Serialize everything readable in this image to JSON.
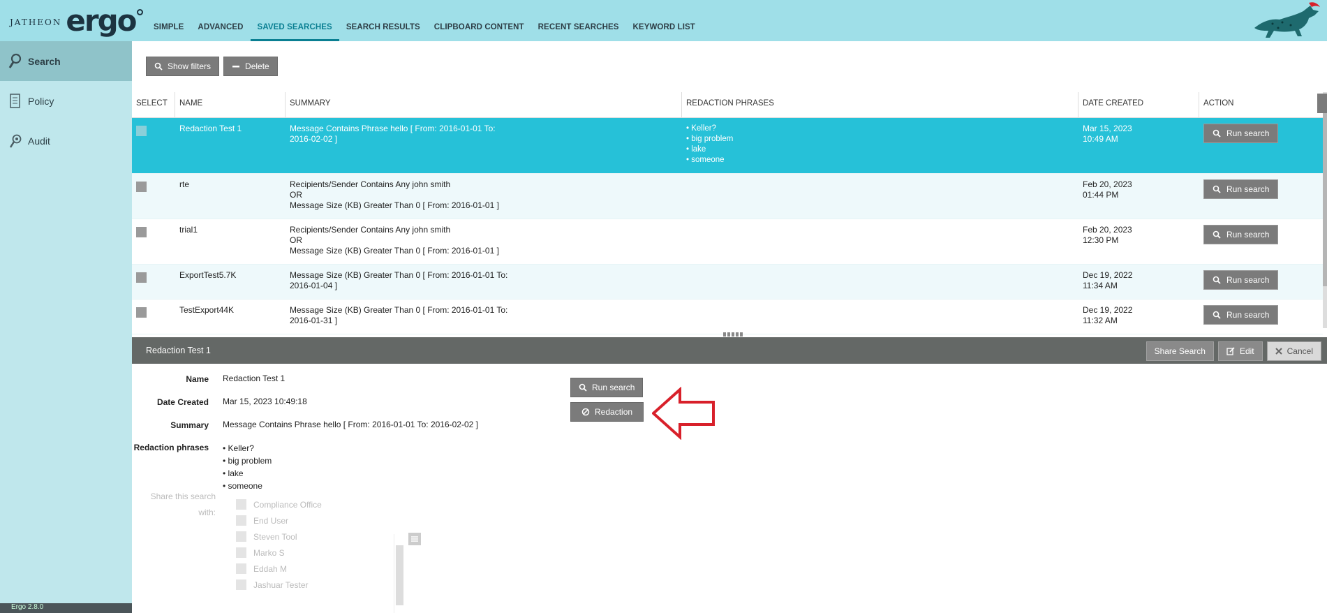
{
  "brand": {
    "prefix": "JATHEON",
    "name": "ergo"
  },
  "nav": {
    "tabs": [
      "SIMPLE",
      "ADVANCED",
      "SAVED SEARCHES",
      "SEARCH RESULTS",
      "CLIPBOARD CONTENT",
      "RECENT SEARCHES",
      "KEYWORD LIST"
    ],
    "active": "SAVED SEARCHES"
  },
  "sidebar": {
    "items": [
      {
        "label": "Search",
        "icon": "magnifier-icon",
        "active": true
      },
      {
        "label": "Policy",
        "icon": "document-icon",
        "active": false
      },
      {
        "label": "Audit",
        "icon": "audit-magnifier-icon",
        "active": false
      }
    ],
    "footer": "Ergo 2.8.0"
  },
  "toolbar": {
    "show_filters": "Show filters",
    "delete": "Delete"
  },
  "table": {
    "headers": [
      "SELECT",
      "NAME",
      "SUMMARY",
      "REDACTION PHRASES",
      "DATE CREATED",
      "ACTION"
    ],
    "rows": [
      {
        "name": "Redaction Test 1",
        "summary": [
          "Message Contains Phrase hello [ From: 2016-01-01 To:",
          "2016-02-02 ]"
        ],
        "phrases": [
          "• Keller?",
          "• big problem",
          "• lake",
          "• someone"
        ],
        "date": "Mar 15, 2023",
        "time": "10:49 AM",
        "action": "Run search"
      },
      {
        "name": "rte",
        "summary": [
          "Recipients/Sender Contains Any john smith",
          "OR",
          "Message Size (KB) Greater Than 0 [ From: 2016-01-01 ]"
        ],
        "phrases": [],
        "date": "Feb 20, 2023",
        "time": "01:44 PM",
        "action": "Run search"
      },
      {
        "name": "trial1",
        "summary": [
          "Recipients/Sender Contains Any john smith",
          "OR",
          "Message Size (KB) Greater Than 0 [ From: 2016-01-01 ]"
        ],
        "phrases": [],
        "date": "Feb 20, 2023",
        "time": "12:30 PM",
        "action": "Run search"
      },
      {
        "name": "ExportTest5.7K",
        "summary": [
          "Message Size (KB) Greater Than 0 [ From: 2016-01-01 To:",
          "2016-01-04 ]"
        ],
        "phrases": [],
        "date": "Dec 19, 2022",
        "time": "11:34 AM",
        "action": "Run search"
      },
      {
        "name": "TestExport44K",
        "summary": [
          "Message Size (KB) Greater Than 0 [ From: 2016-01-01 To:",
          "2016-01-31 ]"
        ],
        "phrases": [],
        "date": "Dec 19, 2022",
        "time": "11:32 AM",
        "action": "Run search"
      }
    ]
  },
  "detail": {
    "title": "Redaction Test 1",
    "share_search": "Share Search",
    "edit": "Edit",
    "cancel": "Cancel",
    "labels": {
      "name": "Name",
      "date_created": "Date Created",
      "summary": "Summary",
      "redaction_phrases": "Redaction phrases",
      "share": "Share this search with:"
    },
    "values": {
      "name": "Redaction Test 1",
      "date_created": "Mar 15, 2023 10:49:18",
      "summary": "Message Contains Phrase hello [ From: 2016-01-01 To: 2016-02-02 ]",
      "phrases": [
        "• Keller?",
        "• big problem",
        "• lake",
        "• someone"
      ]
    },
    "run_search": "Run search",
    "redaction": "Redaction",
    "share_list": [
      "Compliance Office",
      "End User",
      "Steven Tool",
      "Marko S",
      "Eddah M",
      "Jashuar Tester"
    ]
  },
  "colors": {
    "accent": "#26c1d8",
    "topbar": "#9fdfe8",
    "sidebar": "#bfe7ec",
    "arrow": "#d8202a"
  }
}
